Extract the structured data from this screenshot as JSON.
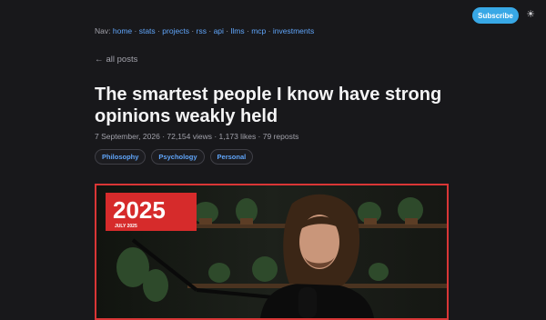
{
  "header": {
    "subscribe_label": "Subscribe",
    "theme_icon": "sun-icon",
    "theme_glyph": "☀"
  },
  "nav": {
    "prefix": "Nav:",
    "links": [
      "home",
      "stats",
      "projects",
      "rss",
      "api",
      "llms",
      "mcp",
      "investments"
    ],
    "separator": "·"
  },
  "back_link": {
    "arrow": "←",
    "label": "all posts"
  },
  "post": {
    "title": "The smartest people I know have strong opinions weakly held",
    "meta": "7 September, 2026 · 72,154 views · 1,173 likes · 79 reposts",
    "tags": [
      "Philosophy",
      "Psychology",
      "Personal"
    ]
  },
  "hero_image": {
    "badge_year": "2025",
    "badge_month": "JULY 2025",
    "border_color": "#d93636",
    "badge_color": "#d62b2b"
  },
  "colors": {
    "background": "#18181b",
    "link": "#60a5fa",
    "accent": "#38a8e6",
    "text": "#f4f4f5",
    "muted": "#a1a1aa"
  }
}
